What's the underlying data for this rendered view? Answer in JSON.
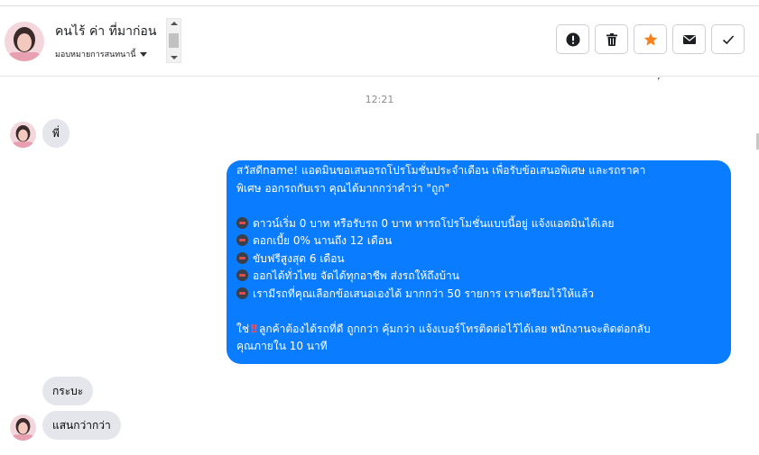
{
  "header": {
    "contact_name": "คนไร้ ค่า ที่มาก่อน",
    "assign_label": "มอบหมายการสนทนานี้",
    "actions": [
      {
        "name": "mark-spam",
        "icon": "exclamation-circle-icon"
      },
      {
        "name": "delete",
        "icon": "trash-icon"
      },
      {
        "name": "star",
        "icon": "star-icon",
        "color": "#f5821f"
      },
      {
        "name": "email",
        "icon": "envelope-icon"
      },
      {
        "name": "done",
        "icon": "check-icon"
      }
    ]
  },
  "chat": {
    "timestamp": "12:21",
    "messages": [
      {
        "direction": "in",
        "text": "พี่"
      },
      {
        "direction": "out",
        "lines": [
          "สวัสดีname! แอดมินขอเสนอรถโปรโมชั่นประจำเดือน เพื่อรับข้อเสนอพิเศษ และรถราคา",
          "พิเศษ ออกรถกับเรา คุณได้มากกว่าคำว่า \"ถูก\"",
          "",
          "ดาวน์เริ่ม 0 บาท หรือรับรถ 0 บาท หารถโปรโมชั่นแบบนี้อยู่ แจ้งแอดมินได้เลย",
          "ดอกเบี้ย 0% นานถึง 12 เดือน",
          "ขับฟรีสูงสุด 6 เดือน",
          "ออกได้ทั่วไทย จัดได้ทุกอาชีพ ส่งรถให้ถึงบ้าน",
          "เรามีรถที่คุณเลือกข้อเสนอเองได้ มากกว่า 50 รายการ เราเตรียมไว้ให้แล้ว",
          "",
          "ใช่",
          "ลูกค้าต้องได้รถที่ดี ถูกกว่า คุ้มกว่า แจ้งเบอร์โทรติดต่อไว้ได้เลย พนักงานจะติดต่อกลับ",
          "คุณภายใน 10 นาที"
        ]
      },
      {
        "direction": "in",
        "text": "กระบะ"
      },
      {
        "direction": "in",
        "text": "แสนกว่ากว่า"
      }
    ]
  },
  "colors": {
    "outgoing_bubble": "#0a7cff",
    "incoming_bubble": "#e4e6eb",
    "star_accent": "#f5821f"
  }
}
